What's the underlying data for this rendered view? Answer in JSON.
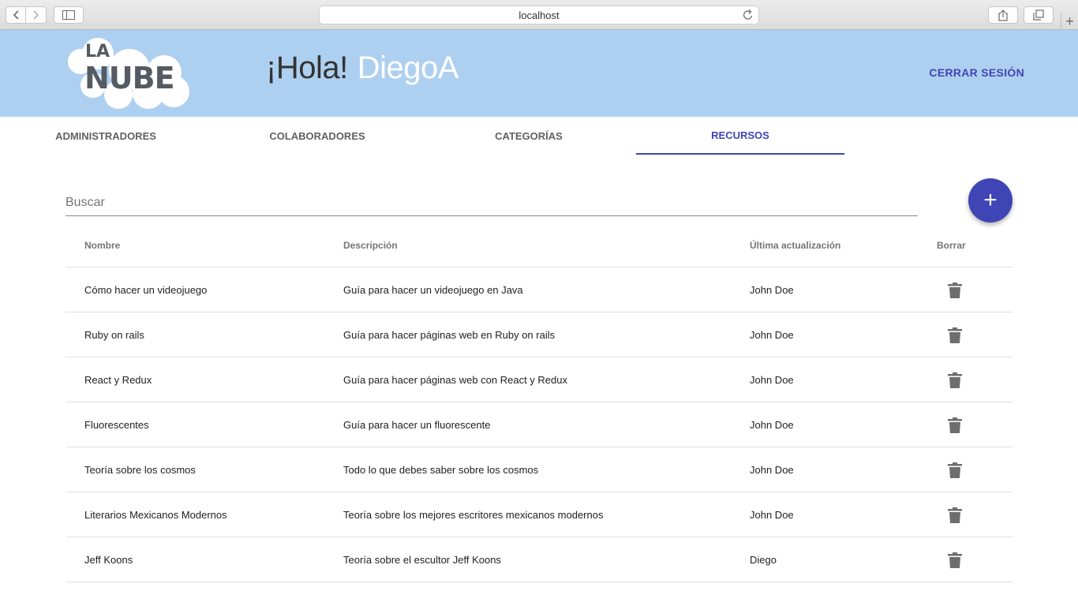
{
  "browser": {
    "url": "localhost"
  },
  "header": {
    "logo_line1": "LA",
    "logo_line2": "NUBE",
    "greeting": "¡Hola!",
    "user_name": "DiegoA",
    "logout_label": "CERRAR SESIÓN",
    "background": "#aed0f0",
    "accent": "#3f45b5"
  },
  "tabs": [
    {
      "label": "ADMINISTRADORES",
      "active": false
    },
    {
      "label": "COLABORADORES",
      "active": false
    },
    {
      "label": "CATEGORÍAS",
      "active": false
    },
    {
      "label": "RECURSOS",
      "active": true
    }
  ],
  "search": {
    "placeholder": "Buscar"
  },
  "fab": {
    "icon": "plus-icon",
    "label": "+"
  },
  "table": {
    "headers": {
      "name": "Nombre",
      "description": "Descripción",
      "updated": "Última actualización",
      "delete": "Borrar"
    },
    "rows": [
      {
        "name": "Cómo hacer un videojuego",
        "description": "Guía para hacer un videojuego en Java",
        "updated": "John Doe"
      },
      {
        "name": "Ruby on rails",
        "description": "Guía para hacer páginas web en Ruby on rails",
        "updated": "John Doe"
      },
      {
        "name": "React y Redux",
        "description": "Guía para hacer páginas web con React y Redux",
        "updated": "John Doe"
      },
      {
        "name": "Fluorescentes",
        "description": "Guía para hacer un fluorescente",
        "updated": "John Doe"
      },
      {
        "name": "Teoría sobre los cosmos",
        "description": "Todo lo que debes saber sobre los cosmos",
        "updated": "John Doe"
      },
      {
        "name": "Literarios Mexicanos Modernos",
        "description": "Teoría sobre los mejores escritores mexicanos modernos",
        "updated": "John Doe"
      },
      {
        "name": "Jeff Koons",
        "description": "Teoría sobre el escultor Jeff Koons",
        "updated": "Diego"
      }
    ],
    "delete_icon": "trash-icon"
  }
}
